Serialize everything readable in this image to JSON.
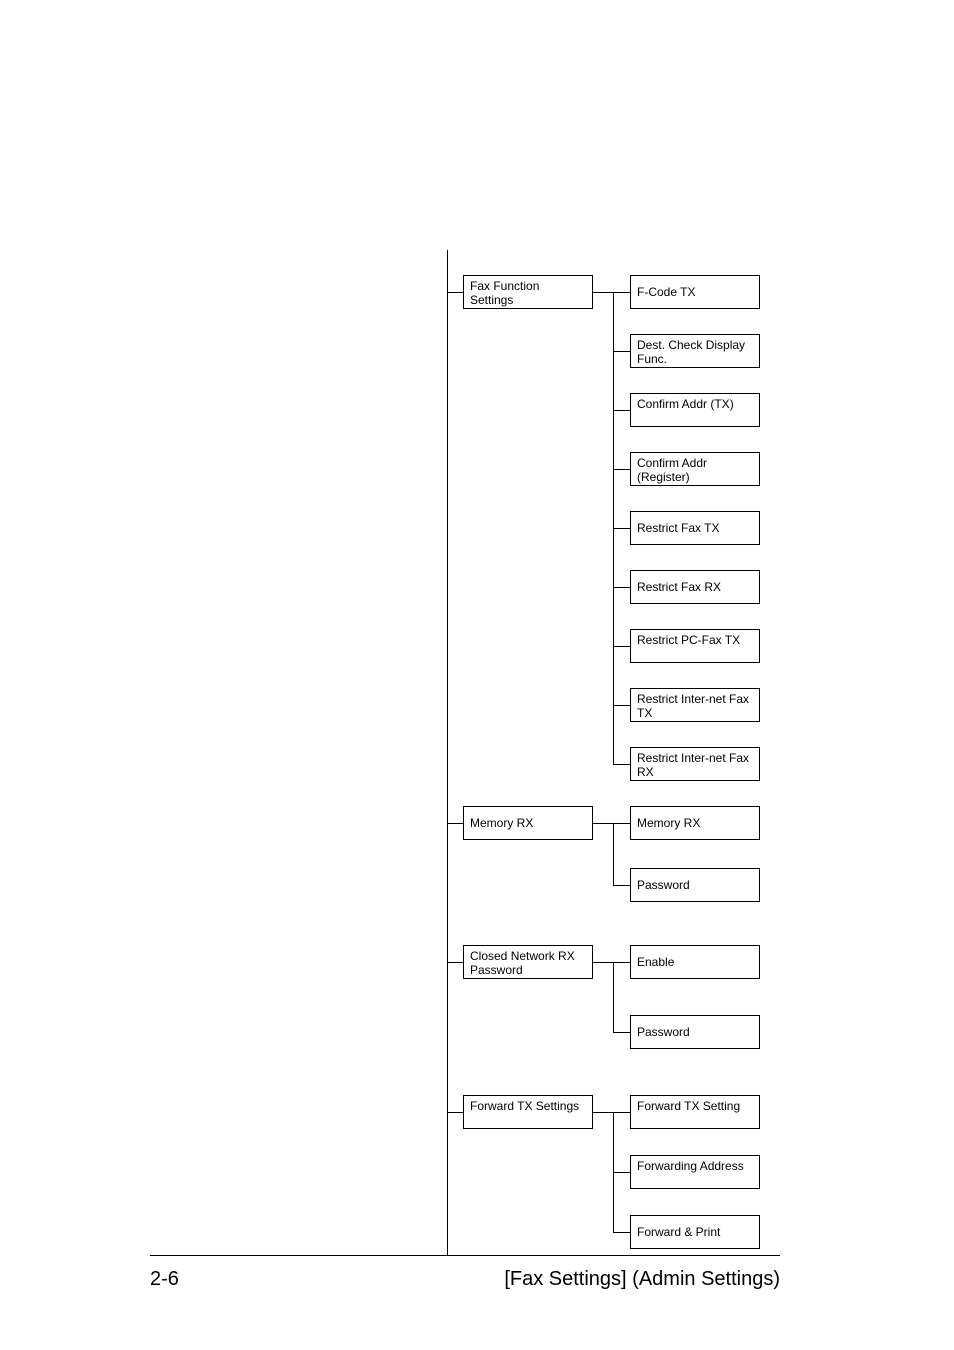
{
  "footer": {
    "page": "2-6",
    "title": "[Fax Settings] (Admin Settings)"
  },
  "col1": {
    "fax_function": "Fax Function Settings",
    "memory_rx": "Memory RX",
    "closed_network": "Closed Network RX Password",
    "forward_tx": "Forward TX Settings"
  },
  "col2": {
    "fcode": "F-Code TX",
    "dest_check": "Dest. Check Display Func.",
    "confirm_tx": "Confirm Addr (TX)",
    "confirm_reg": "Confirm Addr (Register)",
    "restrict_fax_tx": "Restrict Fax TX",
    "restrict_fax_rx": "Restrict Fax RX",
    "restrict_pc_fax": "Restrict PC-Fax TX",
    "restrict_inet_tx": "Restrict Inter-net Fax TX",
    "restrict_inet_rx": "Restrict Inter-net Fax RX",
    "memory_rx": "Memory RX",
    "password1": "Password",
    "enable": "Enable",
    "password2": "Password",
    "forward_tx_setting": "Forward TX Setting",
    "forwarding_addr": "Forwarding Address",
    "forward_print": "Forward & Print"
  }
}
